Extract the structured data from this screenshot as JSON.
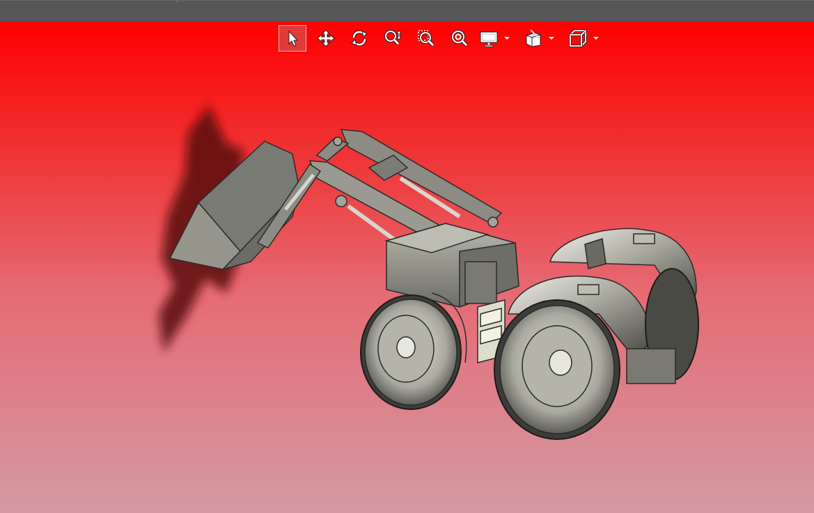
{
  "window": {
    "accent": "#ff0000",
    "background_gradient": [
      "#ff0000",
      "#d39aa2"
    ]
  },
  "toolbar": {
    "tools": [
      {
        "id": "select",
        "icon": "cursor-arrow-icon",
        "active": true
      },
      {
        "id": "pan",
        "icon": "move-arrows-icon",
        "active": false
      },
      {
        "id": "rotate",
        "icon": "rotate-icon",
        "active": false
      },
      {
        "id": "zoom",
        "icon": "zoom-updown-icon",
        "active": false
      },
      {
        "id": "zoom-window",
        "icon": "zoom-window-icon",
        "active": false
      },
      {
        "id": "zoom-fit",
        "icon": "zoom-fit-icon",
        "active": false
      },
      {
        "id": "display",
        "icon": "monitor-icon",
        "dropdown": true
      },
      {
        "id": "section",
        "icon": "section-plane-icon",
        "dropdown": true
      },
      {
        "id": "view",
        "icon": "cube-view-icon",
        "dropdown": true
      }
    ]
  },
  "model": {
    "icon": "tractor-loader-model",
    "body_color": "#8a8a82",
    "shadow_color": "#5a0a0a"
  }
}
